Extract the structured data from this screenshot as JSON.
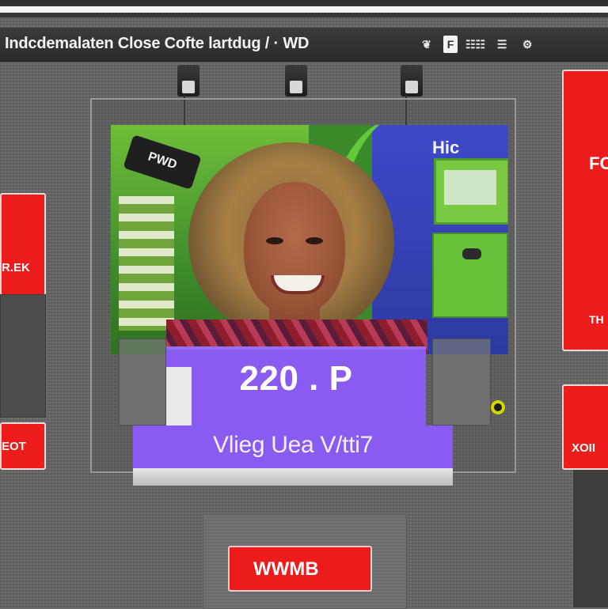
{
  "header": {
    "title": "Indcdemalaten Close Cofte lartdug / · WD",
    "icons": [
      "bird-icon",
      "square-icon",
      "grid-icon",
      "list-icon",
      "settings-icon"
    ],
    "icon_labels": [
      "❦",
      "F",
      "☷☷",
      "☰",
      "⚙"
    ]
  },
  "photo": {
    "camera_label": "PWD",
    "store_label": "Hic"
  },
  "display": {
    "price": "220 . P",
    "subtitle": "Vlieg Uea V/tti7"
  },
  "tags": {
    "left_top": "R.EK",
    "left_bottom": "EOT",
    "right_top": "FC",
    "right_top_small": "TH",
    "right_bottom": "XOII",
    "bottom_center": "WWMB"
  },
  "colors": {
    "accent_red": "#ec1c1c",
    "purple": "#8a5bf0",
    "panel_gray": "#676767"
  }
}
